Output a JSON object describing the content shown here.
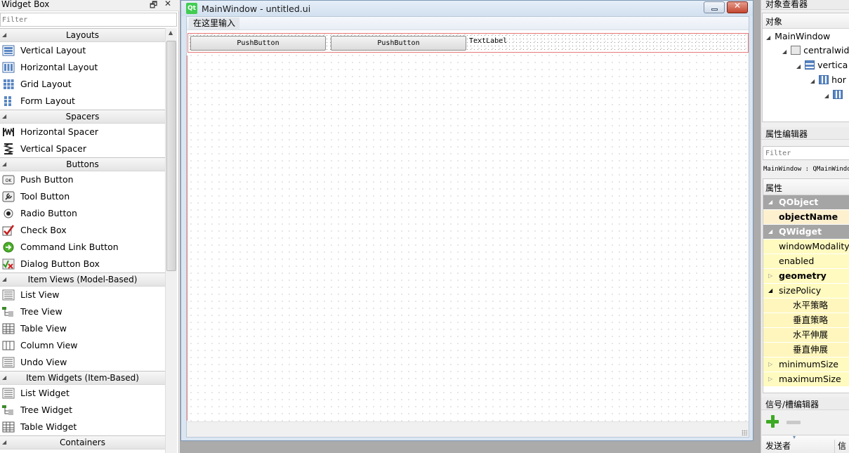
{
  "widget_box": {
    "title": "Widget Box",
    "float_glyph": "🗗",
    "close_glyph": "✕",
    "filter_placeholder": "Filter",
    "categories": [
      {
        "name": "Layouts",
        "items": [
          {
            "label": "Vertical Layout",
            "icon": "vertical-layout-icon"
          },
          {
            "label": "Horizontal Layout",
            "icon": "horizontal-layout-icon"
          },
          {
            "label": "Grid Layout",
            "icon": "grid-layout-icon"
          },
          {
            "label": "Form Layout",
            "icon": "form-layout-icon"
          }
        ]
      },
      {
        "name": "Spacers",
        "items": [
          {
            "label": "Horizontal Spacer",
            "icon": "horizontal-spacer-icon"
          },
          {
            "label": "Vertical Spacer",
            "icon": "vertical-spacer-icon"
          }
        ]
      },
      {
        "name": "Buttons",
        "items": [
          {
            "label": "Push Button",
            "icon": "push-button-icon"
          },
          {
            "label": "Tool Button",
            "icon": "tool-button-icon"
          },
          {
            "label": "Radio Button",
            "icon": "radio-button-icon"
          },
          {
            "label": "Check Box",
            "icon": "check-box-icon"
          },
          {
            "label": "Command Link Button",
            "icon": "command-link-button-icon"
          },
          {
            "label": "Dialog Button Box",
            "icon": "dialog-button-box-icon"
          }
        ]
      },
      {
        "name": "Item Views (Model-Based)",
        "items": [
          {
            "label": "List View",
            "icon": "list-view-icon"
          },
          {
            "label": "Tree View",
            "icon": "tree-view-icon"
          },
          {
            "label": "Table View",
            "icon": "table-view-icon"
          },
          {
            "label": "Column View",
            "icon": "column-view-icon"
          },
          {
            "label": "Undo View",
            "icon": "undo-view-icon"
          }
        ]
      },
      {
        "name": "Item Widgets (Item-Based)",
        "items": [
          {
            "label": "List Widget",
            "icon": "list-widget-icon"
          },
          {
            "label": "Tree Widget",
            "icon": "tree-widget-icon"
          },
          {
            "label": "Table Widget",
            "icon": "table-widget-icon"
          }
        ]
      },
      {
        "name": "Containers",
        "items": []
      }
    ]
  },
  "form": {
    "logo": "Qt",
    "title": "MainWindow - untitled.ui",
    "menu_placeholder": "在这里输入",
    "buttons": [
      "PushButton",
      "PushButton"
    ],
    "label": "TextLabel"
  },
  "object_inspector": {
    "title": "对象查看器",
    "column": "对象",
    "nodes": [
      "MainWindow",
      "centralwid",
      "vertica",
      "hor",
      ""
    ]
  },
  "property_editor": {
    "title": "属性编辑器",
    "filter_placeholder": "Filter",
    "object_line": "MainWindow : QMainWindow",
    "column": "属性",
    "rows": [
      {
        "kind": "group",
        "name": "QObject"
      },
      {
        "kind": "selected",
        "name": "objectName"
      },
      {
        "kind": "group",
        "name": "QWidget"
      },
      {
        "kind": "plain",
        "name": "windowModality"
      },
      {
        "kind": "plain",
        "name": "enabled"
      },
      {
        "kind": "bold",
        "name": "geometry",
        "collapsed": true
      },
      {
        "kind": "plain",
        "name": "sizePolicy",
        "expanded": true
      },
      {
        "kind": "sub",
        "name": "水平策略"
      },
      {
        "kind": "sub",
        "name": "垂直策略"
      },
      {
        "kind": "sub",
        "name": "水平伸展"
      },
      {
        "kind": "sub",
        "name": "垂直伸展"
      },
      {
        "kind": "plain",
        "name": "minimumSize",
        "collapsed": true
      },
      {
        "kind": "plain",
        "name": "maximumSize",
        "collapsed": true
      }
    ]
  },
  "signal_slot_editor": {
    "title": "信号/槽编辑器",
    "col_sender": "发送者",
    "col_signal": "信号"
  },
  "colors": {
    "layout_highlight": "#e87878",
    "property_group": "#a5a5a5",
    "property_row": "#fffabf",
    "add_icon": "#3caa23"
  }
}
